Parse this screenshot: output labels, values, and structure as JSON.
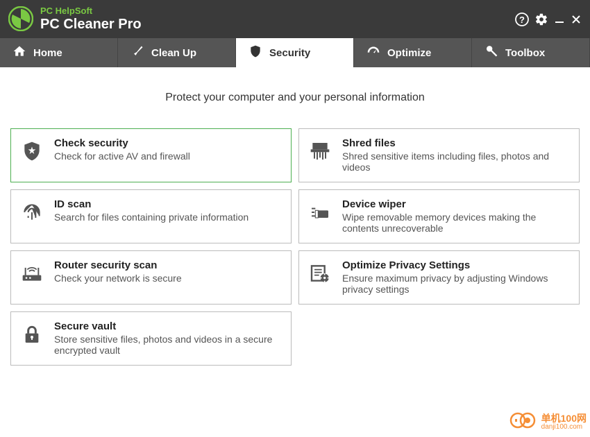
{
  "header": {
    "brand": "PC HelpSoft",
    "product": "PC Cleaner Pro"
  },
  "nav": {
    "home": "Home",
    "cleanup": "Clean Up",
    "security": "Security",
    "optimize": "Optimize",
    "toolbox": "Toolbox"
  },
  "headline": "Protect your computer and your personal information",
  "cards": {
    "check_security": {
      "title": "Check security",
      "desc": "Check for active AV and firewall"
    },
    "id_scan": {
      "title": "ID scan",
      "desc": "Search for files containing private information"
    },
    "router_scan": {
      "title": "Router security scan",
      "desc": "Check your network is secure"
    },
    "secure_vault": {
      "title": "Secure vault",
      "desc": "Store sensitive files, photos and videos in a secure encrypted vault"
    },
    "shred_files": {
      "title": "Shred files",
      "desc": "Shred sensitive items including files, photos and videos"
    },
    "device_wiper": {
      "title": "Device wiper",
      "desc": "Wipe removable memory devices making the contents unrecoverable"
    },
    "privacy_settings": {
      "title": "Optimize Privacy Settings",
      "desc": "Ensure maximum privacy by adjusting Windows privacy settings"
    }
  },
  "watermark": {
    "main": "单机100网",
    "sub": "danji100.com"
  }
}
